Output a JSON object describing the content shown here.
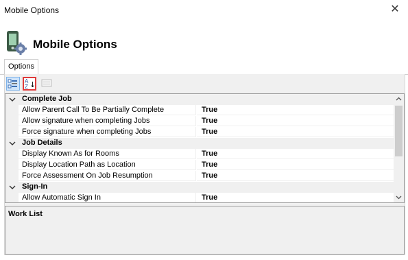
{
  "window": {
    "title": "Mobile Options",
    "close_glyph": "✕"
  },
  "header": {
    "title": "Mobile Options",
    "icon": "mobile-settings-icon"
  },
  "tabs": [
    {
      "label": "Options",
      "selected": true
    }
  ],
  "toolbar": {
    "buttons": [
      {
        "name": "categorized-view-icon",
        "selected": true
      },
      {
        "name": "alphabetical-sort-icon",
        "highlighted": true,
        "glyph_top": "A",
        "glyph_bottom": "Z",
        "glyph_arrow": "↓"
      },
      {
        "name": "property-pages-icon",
        "enabled": false
      }
    ]
  },
  "property_grid": {
    "categories": [
      {
        "label": "Complete Job",
        "items": [
          {
            "name": "Allow Parent Call To Be Partially Complete",
            "value": "True"
          },
          {
            "name": "Allow signature when completing Jobs",
            "value": "True"
          },
          {
            "name": "Force signature when completing Jobs",
            "value": "True"
          }
        ]
      },
      {
        "label": "Job Details",
        "items": [
          {
            "name": "Display Known As for Rooms",
            "value": "True"
          },
          {
            "name": "Display Location Path as Location",
            "value": "True"
          },
          {
            "name": "Force Assessment On Job Resumption",
            "value": "True"
          }
        ]
      },
      {
        "label": "Sign-In",
        "items": [
          {
            "name": "Allow Automatic Sign In",
            "value": "True"
          }
        ]
      }
    ]
  },
  "description": {
    "title": "Work List"
  },
  "colors": {
    "accent": "#7fb4ea",
    "highlight_border": "#e03a3a",
    "panel": "#f0f0f0"
  }
}
